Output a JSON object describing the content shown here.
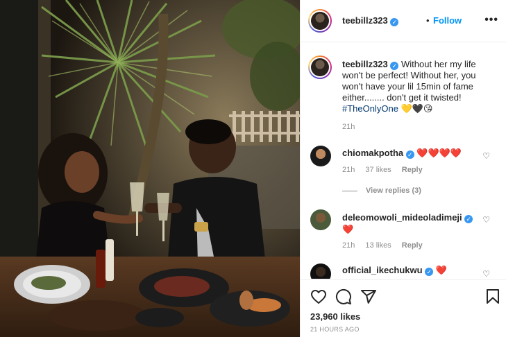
{
  "post": {
    "username": "teebillz323",
    "follow_label": "Follow",
    "dot": "•",
    "more_label": "•••"
  },
  "caption": {
    "username": "teebillz323",
    "text": "Without her my life won't be perfect! Without her, you won't have your lil 15min of fame either........ don't get it twisted!",
    "hashtag": "#TheOnlyOne",
    "emojis": "💛🖤😘",
    "time": "21h"
  },
  "comments": [
    {
      "username": "chiomakpotha",
      "verified": true,
      "text": "❤️❤️❤️❤️",
      "time": "21h",
      "likes": "37 likes",
      "reply": "Reply"
    },
    {
      "username": "deleomowoli_mideoladimeji",
      "verified": true,
      "text": "❤️",
      "time": "21h",
      "likes": "13 likes",
      "reply": "Reply"
    },
    {
      "username": "official_ikechukwu",
      "verified": true,
      "text": "❤️"
    }
  ],
  "view_replies": "View replies (3)",
  "footer": {
    "likes": "23,960 likes",
    "ago": "21 HOURS AGO"
  },
  "colors": {
    "accent": "#0095f6",
    "verified": "#3897f0",
    "heart": "#ed4956"
  }
}
